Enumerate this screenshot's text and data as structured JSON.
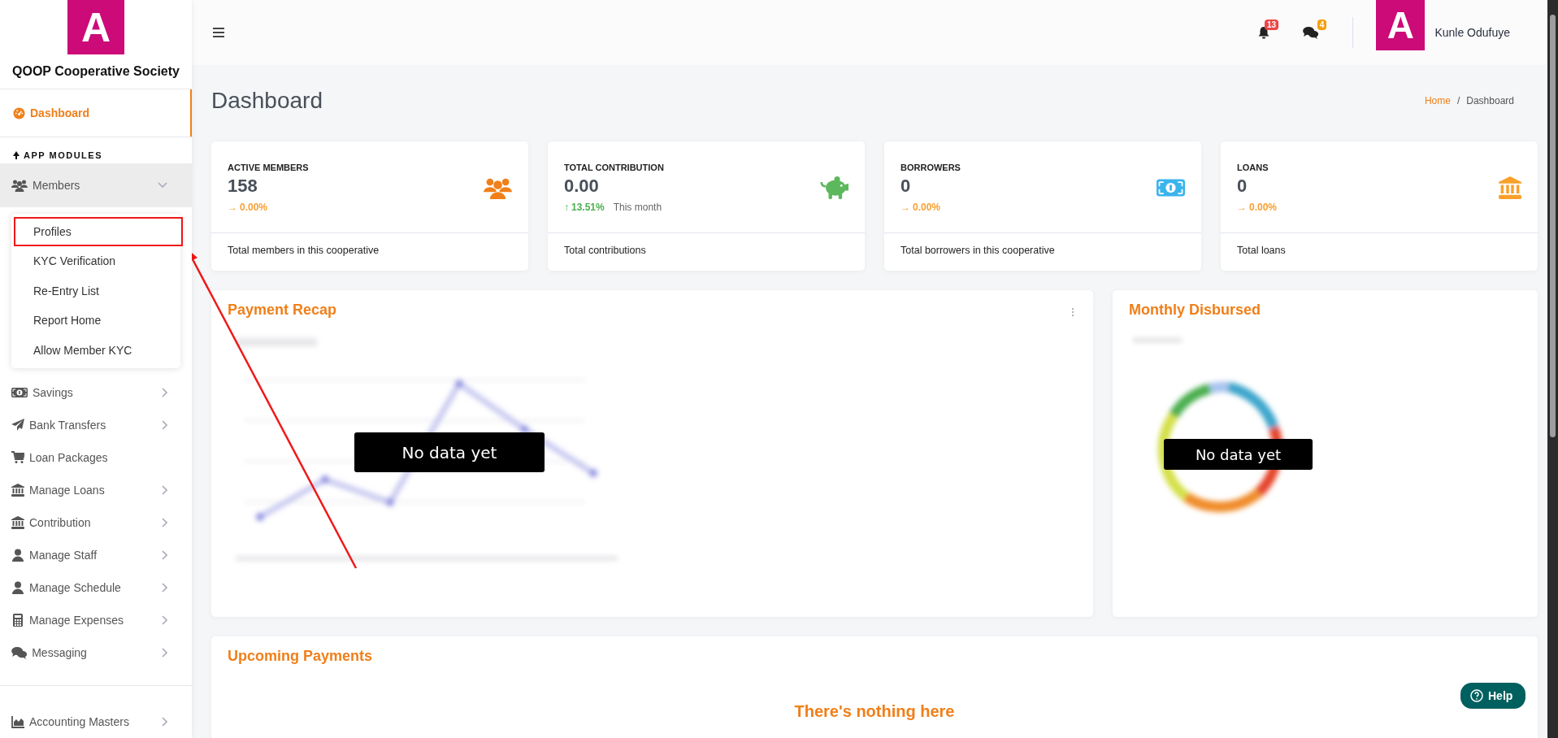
{
  "sidebar": {
    "logo": {
      "letter": "A",
      "name": "QOOP Cooperative Society"
    },
    "items": [
      {
        "label": "Dashboard",
        "kind": "gauge",
        "selected": true
      }
    ],
    "section": {
      "label": "APP MODULES"
    },
    "modules": [
      {
        "label": "Members",
        "kind": "users",
        "chevron": true,
        "expanded": true,
        "children": [
          {
            "label": "Profiles",
            "highlighted": true
          },
          {
            "label": "KYC Verification",
            "highlighted": false
          },
          {
            "label": "Re-Entry List",
            "highlighted": false
          },
          {
            "label": "Report Home",
            "highlighted": false
          },
          {
            "label": "Allow Member KYC",
            "highlighted": false
          }
        ]
      },
      {
        "label": "Savings",
        "kind": "money",
        "chevron": true,
        "expanded": false
      },
      {
        "label": "Bank Transfers",
        "kind": "plane",
        "chevron": true,
        "expanded": false
      },
      {
        "label": "Loan Packages",
        "kind": "cart",
        "chevron": false,
        "expanded": false
      },
      {
        "label": "Manage Loans",
        "kind": "bank",
        "chevron": true,
        "expanded": false
      },
      {
        "label": "Contribution",
        "kind": "bank",
        "chevron": true,
        "expanded": false
      },
      {
        "label": "Manage Staff",
        "kind": "user",
        "chevron": true,
        "expanded": false
      },
      {
        "label": "Manage Schedule",
        "kind": "user",
        "chevron": true,
        "expanded": false
      },
      {
        "label": "Manage Expenses",
        "kind": "calculator",
        "chevron": true,
        "expanded": false
      },
      {
        "label": "Messaging",
        "kind": "chat",
        "chevron": true,
        "expanded": false
      }
    ],
    "footer_modules": [
      {
        "label": "Accounting Masters",
        "kind": "chart",
        "chevron": true,
        "expanded": false
      }
    ]
  },
  "header": {
    "notifications": [
      {
        "kind": "bell",
        "count": "13",
        "color": "#ef4444"
      },
      {
        "kind": "chat",
        "count": "4",
        "color": "#f59e0b"
      }
    ],
    "user": {
      "avatar_letter": "A",
      "name": "Kunle Odufuye"
    }
  },
  "page": {
    "title": "Dashboard",
    "breadcrumb": [
      {
        "label": "Home",
        "current": false
      },
      {
        "label": "Dashboard",
        "current": true
      }
    ],
    "breadcrumb_separator": "/"
  },
  "stats": [
    {
      "kind": "users",
      "label": "ACTIVE MEMBERS",
      "value": "158",
      "arrow": "→",
      "change": "0.00%",
      "color": "#f7a035",
      "footer": "Total members in this cooperative"
    },
    {
      "kind": "piggy",
      "label": "TOTAL CONTRIBUTION",
      "value": "0.00",
      "arrow": "↑",
      "change": "13.51%",
      "color": "#4caf50",
      "note": "This month",
      "footer": "Total contributions"
    },
    {
      "kind": "money",
      "label": "BORROWERS",
      "value": "0",
      "arrow": "→",
      "change": "0.00%",
      "color": "#f7a035",
      "footer": "Total borrowers in this cooperative"
    },
    {
      "kind": "bank",
      "label": "LOANS",
      "value": "0",
      "arrow": "→",
      "change": "0.00%",
      "color": "#f7a035",
      "footer": "Total loans"
    }
  ],
  "payment_recap": {
    "title": "Payment Recap",
    "overlay": "No data yet"
  },
  "monthly_disbursed": {
    "title": "Monthly Disbursed",
    "overlay": "No data yet"
  },
  "upcoming_payments": {
    "title": "Upcoming Payments",
    "empty_title": "There's nothing here"
  },
  "help": {
    "label": "Help"
  }
}
